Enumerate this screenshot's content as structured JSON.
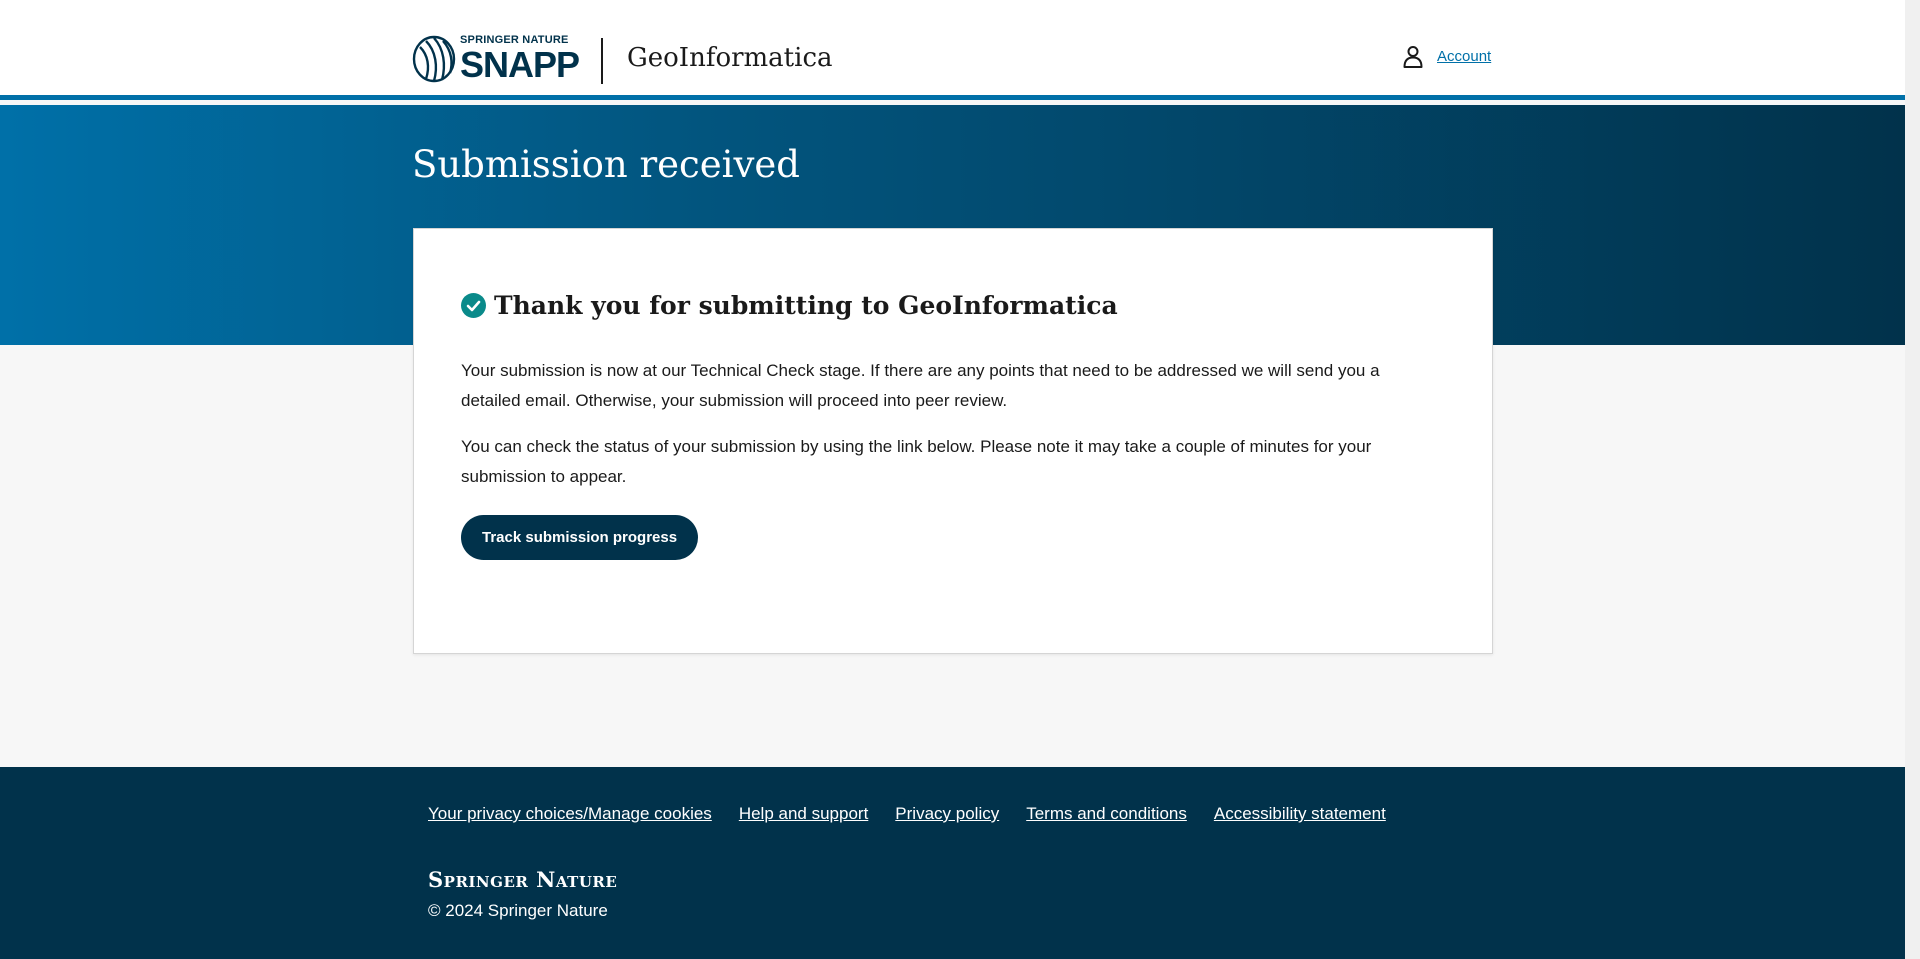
{
  "header": {
    "logo_small": "SPRINGER NATURE",
    "logo_big": "SNAPP",
    "journal": "GeoInformatica",
    "account_label": "Account"
  },
  "hero": {
    "title": "Submission received"
  },
  "card": {
    "heading": "Thank you for submitting to GeoInformatica",
    "paragraph1": "Your submission is now at our Technical Check stage. If there are any points that need to be addressed we will send you a detailed email. Otherwise, your submission will proceed into peer review.",
    "paragraph2": "You can check the status of your submission by using the link below. Please note it may take a couple of minutes for your submission to appear.",
    "button_label": "Track submission progress"
  },
  "footer": {
    "links": [
      "Your privacy choices/Manage cookies",
      "Help and support",
      "Privacy policy",
      "Terms and conditions",
      "Accessibility statement"
    ],
    "brand": "Springer Nature",
    "copyright": "© 2024 Springer Nature"
  },
  "icons": {
    "logo": "snapp-logo-icon",
    "account": "user-icon",
    "success": "check-circle-icon"
  },
  "colors": {
    "brand_dark": "#01324b",
    "brand_blue": "#0070a8",
    "success_teal": "#0a8a8a"
  }
}
